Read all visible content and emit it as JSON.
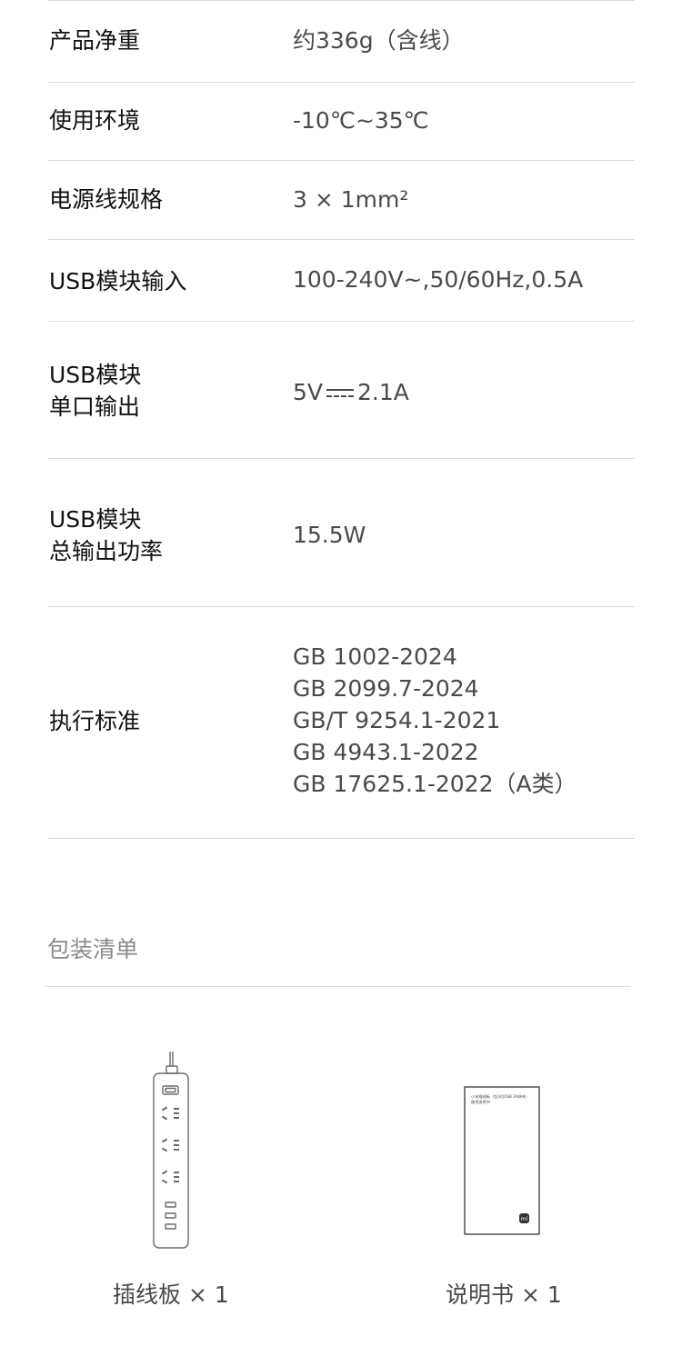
{
  "specs": [
    {
      "label": [
        "产品净重"
      ],
      "value": [
        "约336g（含线）"
      ]
    },
    {
      "label": [
        "使用环境"
      ],
      "value": [
        "-10℃~35℃"
      ]
    },
    {
      "label": [
        "电源线规格"
      ],
      "value": [
        "3 × 1mm²"
      ]
    },
    {
      "label": [
        "USB模块输入"
      ],
      "value": [
        "100-240V~,50/60Hz,0.5A"
      ]
    },
    {
      "label": [
        "USB模块",
        "单口输出"
      ],
      "value_prefix": "5V",
      "value_suffix": "2.1A"
    },
    {
      "label": [
        "USB模块",
        "总输出功率"
      ],
      "value": [
        "15.5W"
      ]
    },
    {
      "label": [
        "执行标准"
      ],
      "value": [
        "GB 1002-2024",
        "GB 2099.7-2024",
        "GB/T 9254.1-2021",
        "GB 4943.1-2022",
        "GB 17625.1-2022（A类）"
      ]
    }
  ],
  "package": {
    "title": "包装清单",
    "items": [
      {
        "caption": "插线板 × 1",
        "icon": "power-strip-icon"
      },
      {
        "caption": "说明书 × 1",
        "icon": "manual-icon",
        "cover_text": [
          "小米插线板（含3位USB 2A快充）",
          "使用说明书"
        ],
        "logo": "mi"
      }
    ]
  }
}
